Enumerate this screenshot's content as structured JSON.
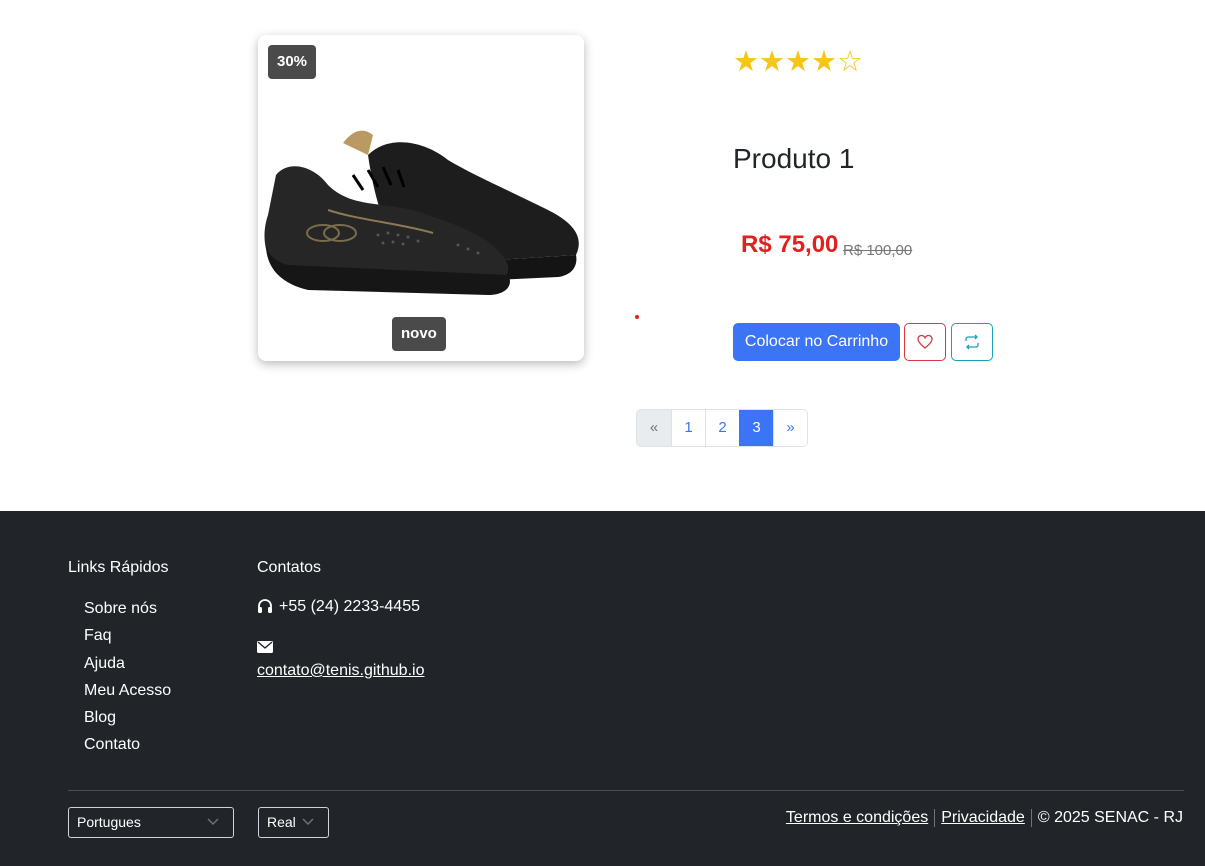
{
  "product": {
    "discount_badge": "30%",
    "new_badge": "novo",
    "rating": {
      "value": 4,
      "max": 5,
      "stars": [
        "★",
        "★",
        "★",
        "★",
        "☆"
      ]
    },
    "name": "Produto 1",
    "price": "R$ 75,00",
    "old_price": "R$ 100,00",
    "add_to_cart_label": "Colocar no Carrinho",
    "image_icon": "sneaker-image"
  },
  "pagination": {
    "prev": "«",
    "pages": [
      "1",
      "2",
      "3"
    ],
    "active": "3",
    "next": "»"
  },
  "footer": {
    "quick_links_title": "Links Rápidos",
    "quick_links": [
      "Sobre nós",
      "Faq",
      "Ajuda",
      "Meu Acesso",
      "Blog",
      "Contato"
    ],
    "contacts_title": "Contatos",
    "phone": "+55 (24) 2233-4455",
    "email": "contato@tenis.github.io",
    "language_select": "Portugues",
    "currency_select": "Real",
    "terms_label": "Termos e condições",
    "privacy_label": "Privacidade",
    "copyright": "© 2025 SENAC - RJ"
  },
  "colors": {
    "primary": "#3b74f5",
    "price": "#e32020",
    "star": "#f5c518",
    "footer_bg": "#212529",
    "badge_bg": "#4a4a4a"
  }
}
